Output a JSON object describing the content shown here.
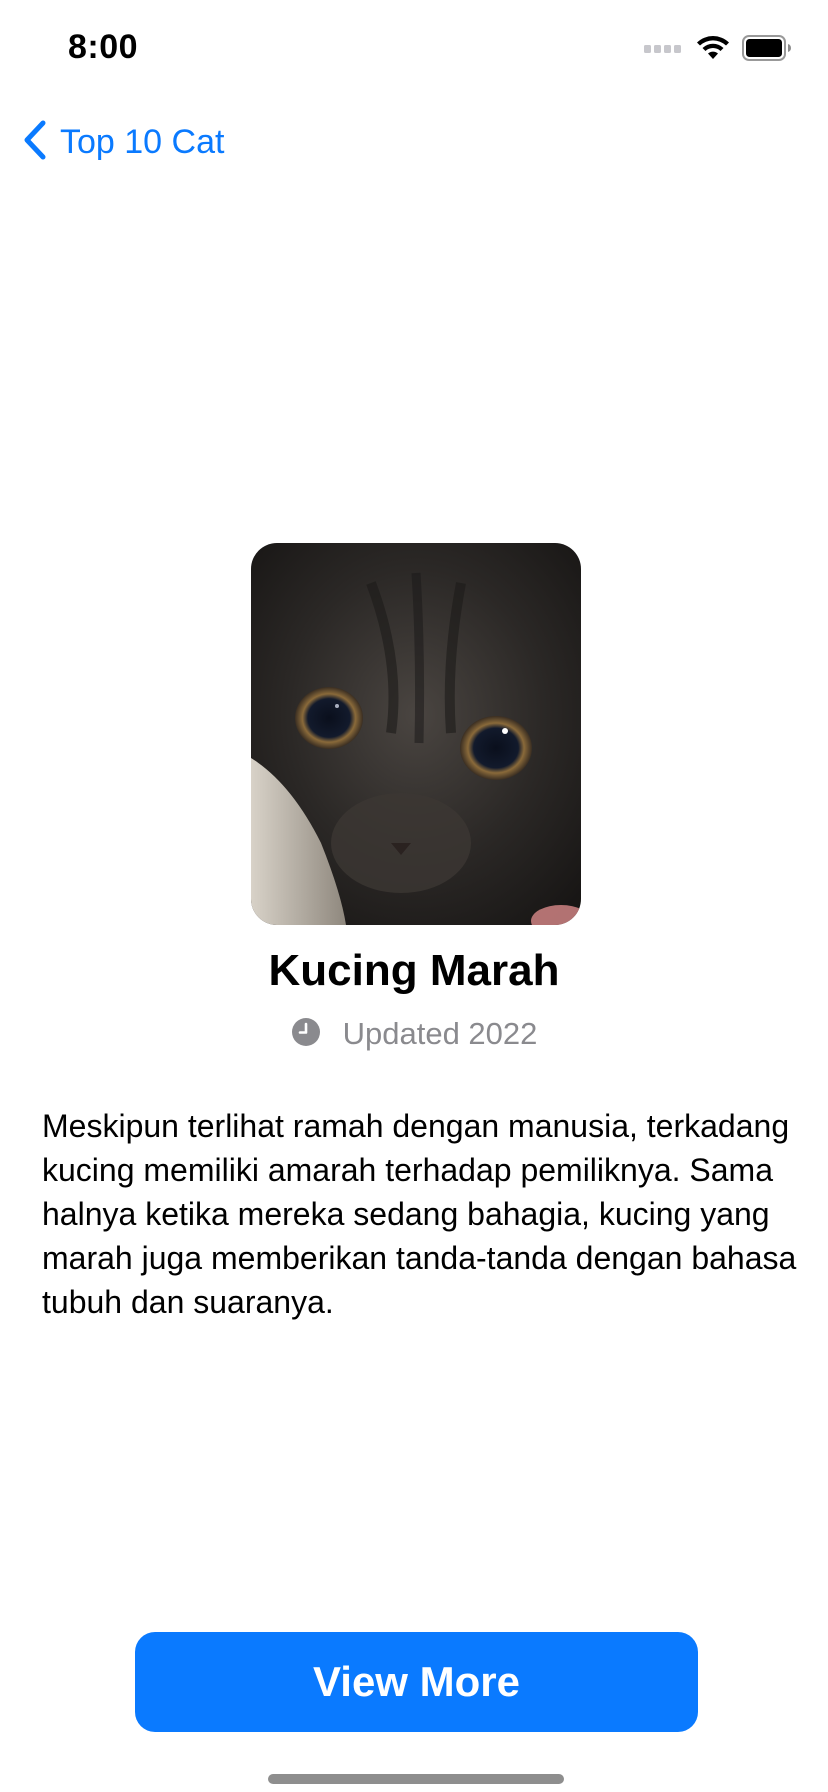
{
  "status_bar": {
    "time": "8:00",
    "icons": [
      "cellular-signal-icon",
      "wifi-icon",
      "battery-icon"
    ]
  },
  "nav": {
    "back_label": "Top 10 Cat",
    "back_icon": "chevron-left-icon"
  },
  "detail": {
    "image_alt": "cat-photo",
    "title": "Kucing Marah",
    "updated_icon": "clock-icon",
    "updated_text": "Updated 2022",
    "description": "Meskipun terlihat ramah dengan manusia, terkadang kucing memiliki amarah terhadap pemiliknya. Sama halnya ketika mereka sedang bahagia, kucing yang marah juga memberikan tanda-tanda dengan bahasa tubuh dan suaranya."
  },
  "actions": {
    "view_more_label": "View More"
  },
  "colors": {
    "accent": "#0a7aff",
    "secondary_text": "#8a8a8e",
    "background": "#ffffff"
  }
}
